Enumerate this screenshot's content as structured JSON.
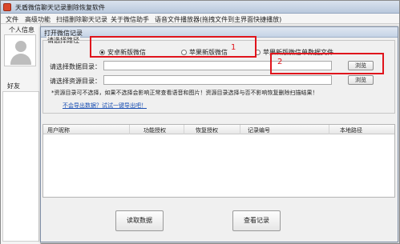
{
  "main_window": {
    "title": "天盾微信聊天记录删除恢复软件",
    "menu": [
      "文件",
      "高级功能",
      "扫描删除聊天记录",
      "关于微信助手",
      "语音文件播放器(拖拽文件到主界面快捷播放)"
    ],
    "personal_info_label": "个人信息",
    "friends_label": "好友"
  },
  "dialog": {
    "title": "打开微信记录",
    "group_label": "请选择路径",
    "radio_android": "安卓新版微信",
    "radio_apple": "苹果新版微信",
    "radio_apple_single": "苹果新版微信单数据文件",
    "selected_option": "安卓新版微信",
    "data_dir_label": "请选择数据目录：",
    "data_dir_value": "",
    "resource_dir_label": "请选择资源目录：",
    "resource_dir_value": "",
    "browse_label": "浏览",
    "note": "*资源目录可不选择，如果不选择会影响正常查看语音和图片！资源目录选择与否不影响恢复删除扫描结果！",
    "link": "不会导出数据？试试一键导出吧！",
    "table_columns": [
      "用户昵称",
      "功能授权",
      "恢复授权",
      "记录编号",
      "本地路径"
    ],
    "read_button": "读取数据",
    "view_button": "查看记录"
  },
  "annotations": {
    "marker_1": "1",
    "marker_2": "2",
    "color": "#e0141c"
  }
}
